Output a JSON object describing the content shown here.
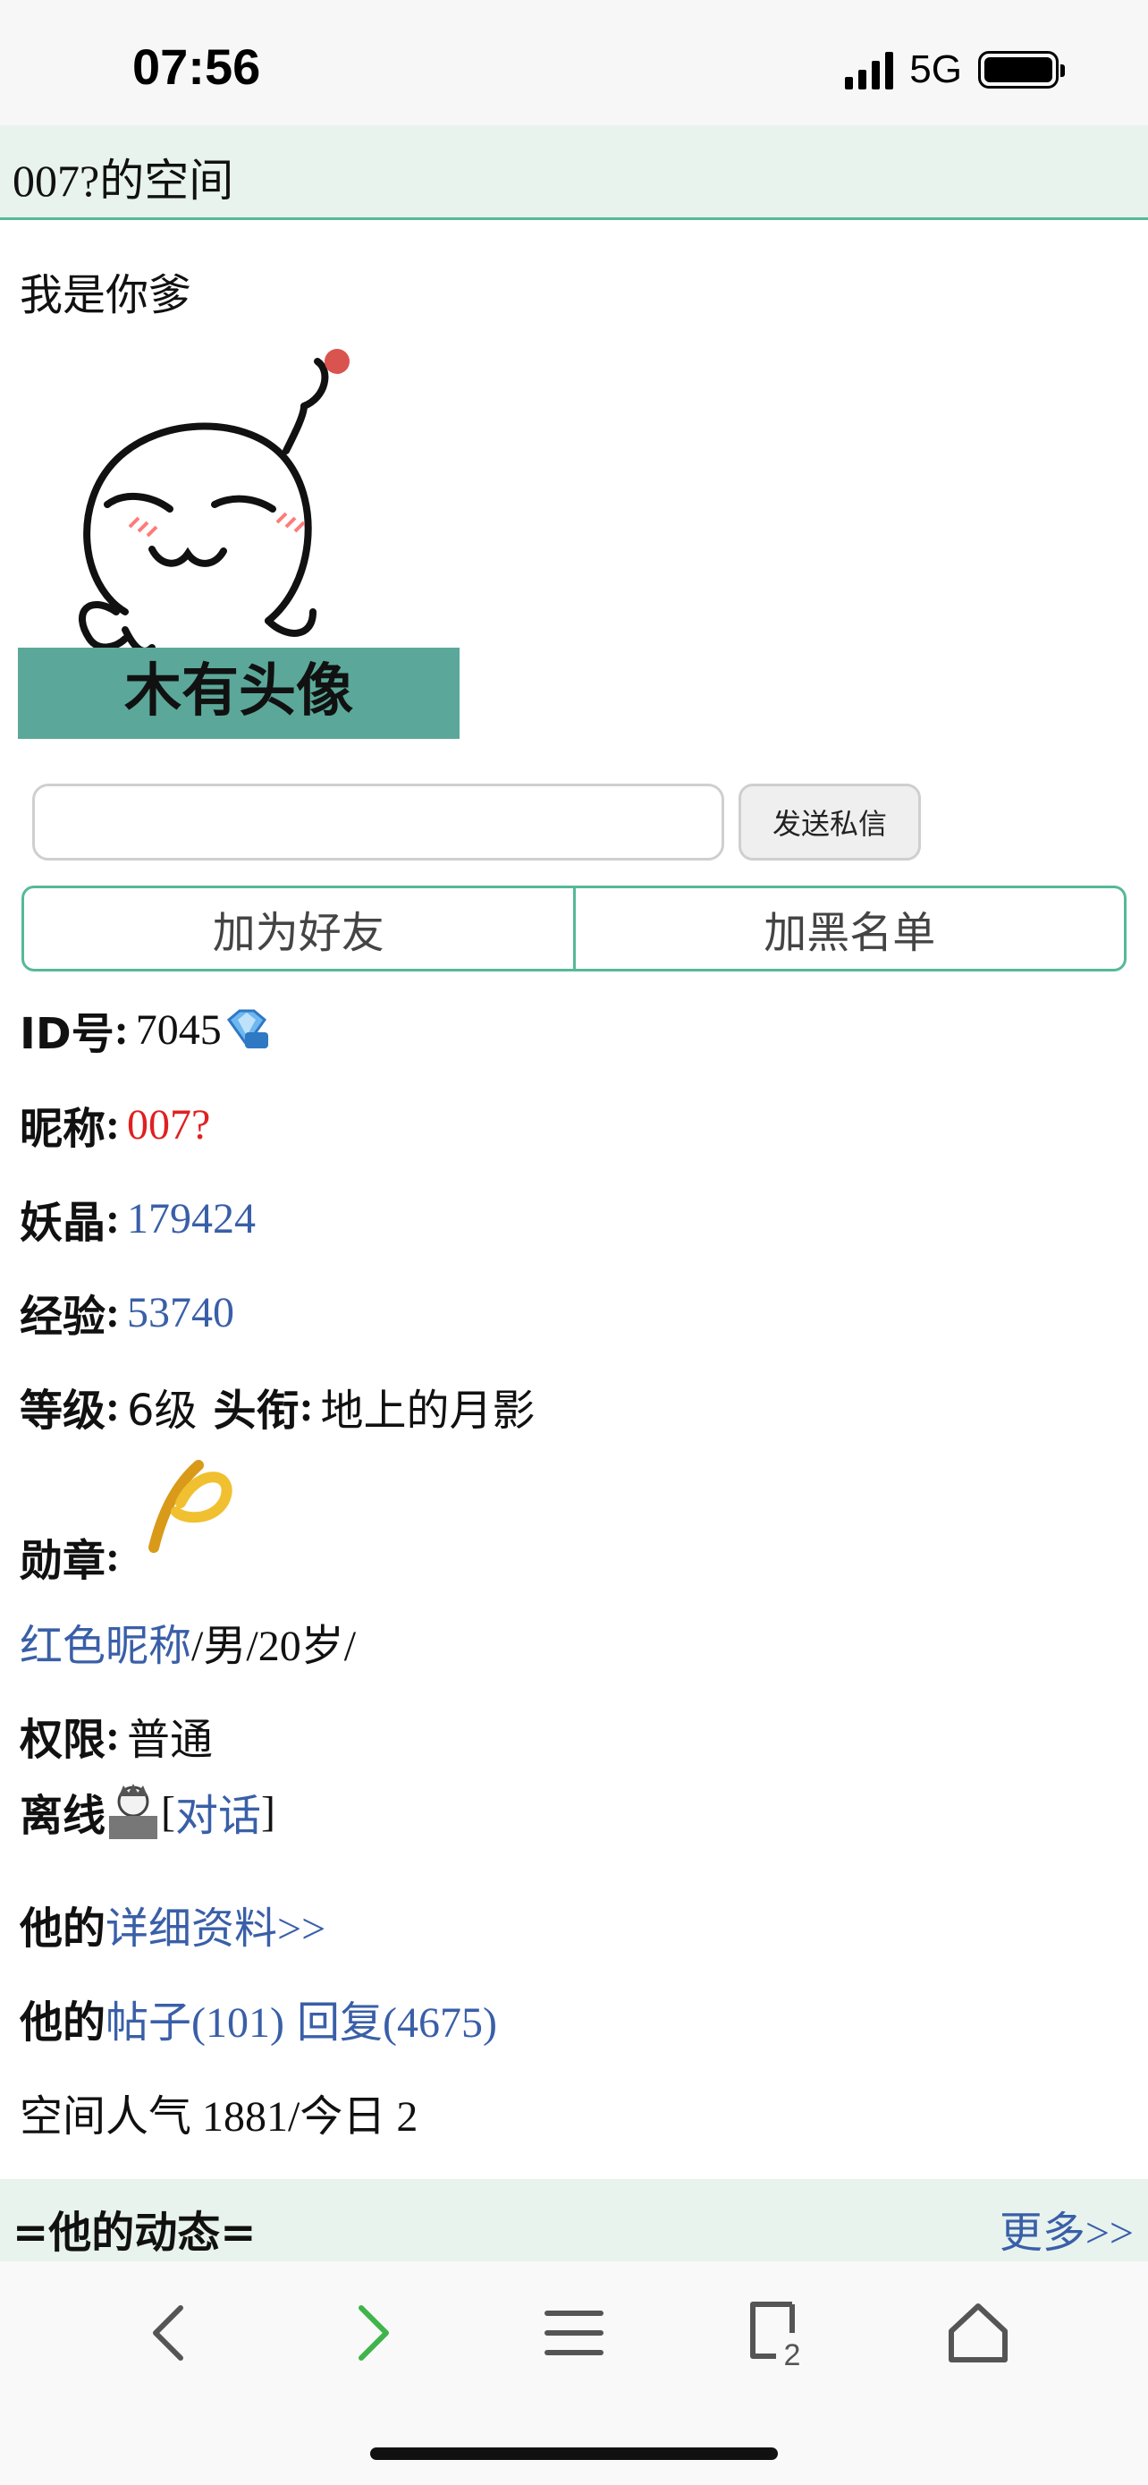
{
  "status_bar": {
    "time": "07:56",
    "network": "5G",
    "icons": [
      "signal-icon",
      "battery-icon"
    ]
  },
  "header": {
    "title": "007?的空间"
  },
  "profile": {
    "signature": "我是你爹",
    "avatar_caption": "木有头像",
    "message_input": {
      "value": "",
      "placeholder": ""
    },
    "send_button": "发送私信",
    "add_friend": "加为好友",
    "blacklist": "加黑名单",
    "id": {
      "label": "ID号",
      "colon": ":",
      "value": "7045",
      "icon": "diamond-vip-icon"
    },
    "nickname": {
      "label": "昵称",
      "colon": ":",
      "value": "007?"
    },
    "crystals": {
      "label": "妖晶",
      "colon": ":",
      "value": "179424"
    },
    "experience": {
      "label": "经验",
      "colon": ":",
      "value": "53740"
    },
    "level": {
      "label": "等级",
      "colon": ":",
      "value": "6级",
      "title_label": "头衔",
      "title_value": "地上的月影"
    },
    "medals": {
      "label": "勋章",
      "colon": ":",
      "icon": "medal-icon"
    },
    "tags": {
      "link": "红色昵称",
      "text": "/男/20岁/"
    },
    "permission": {
      "label": "权限",
      "colon": ":",
      "value": "普通"
    },
    "online": {
      "status": "离线",
      "open": "[",
      "chat_link": "对话",
      "close": "]",
      "icon": "face-avatar-icon"
    },
    "details": {
      "prefix": "他的",
      "link": "详细资料>>"
    },
    "posts": {
      "prefix": "他的",
      "posts_link": "帖子(101)",
      "replies_link": "回复(4675)"
    },
    "popularity": "空间人气 1881/今日 2"
  },
  "activity": {
    "title": "=他的动态=",
    "more": "更多>>"
  },
  "toolbar": {
    "items": [
      "back-icon",
      "forward-icon",
      "menu-icon",
      "tabs-icon",
      "home-icon"
    ],
    "tab_count": "2"
  },
  "colors": {
    "accent": "#55b997",
    "header_bg": "#e8f3ee",
    "link": "#3a5fa8",
    "nickname_red": "#e02020",
    "forward_green": "#3fb44a"
  }
}
